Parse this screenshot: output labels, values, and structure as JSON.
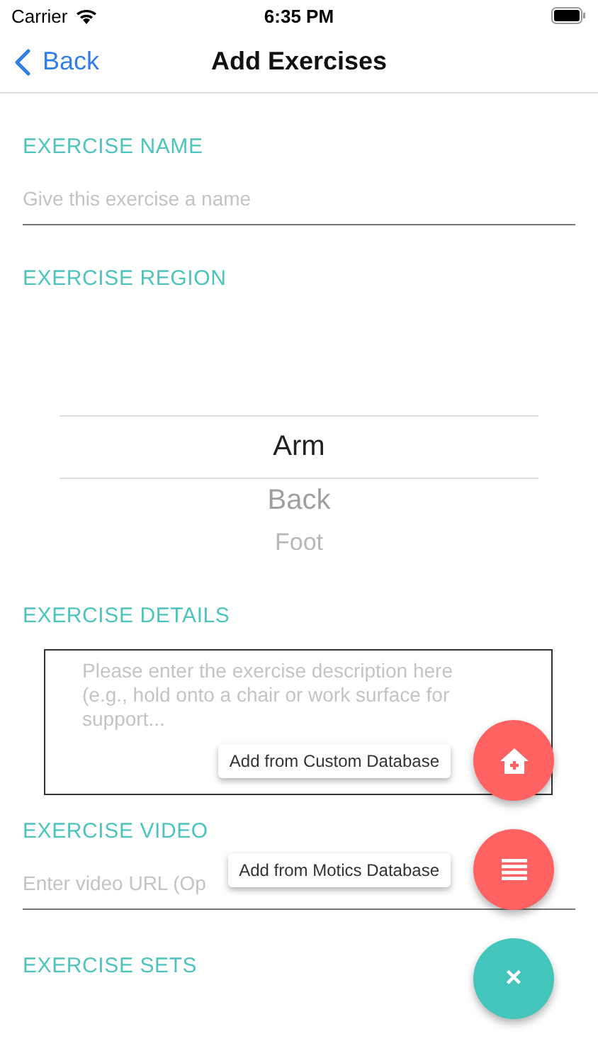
{
  "status_bar": {
    "carrier": "Carrier",
    "time": "6:35 PM"
  },
  "nav": {
    "back": "Back",
    "title": "Add Exercises"
  },
  "sections": [
    {
      "kind": "text",
      "label": "EXERCISE NAME",
      "placeholder": "Give this exercise a name"
    },
    {
      "kind": "picker",
      "label": "EXERCISE REGION",
      "options": [
        {
          "label": "Arm",
          "selected": true
        },
        {
          "label": "Back",
          "selected": false
        },
        {
          "label": "Foot",
          "selected": false
        }
      ]
    },
    {
      "kind": "textarea",
      "label": "EXERCISE DETAILS",
      "placeholder": "Please enter the exercise description here (e.g., hold onto a chair or work surface for support..."
    },
    {
      "kind": "text",
      "label": "EXERCISE VIDEO",
      "placeholder": "Enter video URL (Op"
    },
    {
      "kind": "header",
      "label": "EXERCISE SETS"
    }
  ],
  "fab_actions": [
    {
      "kind": "custom",
      "tooltip": "Add from Custom Database"
    },
    {
      "kind": "list",
      "tooltip": "Add from Motics Database"
    }
  ],
  "fab_close": {
    "label": "×"
  }
}
